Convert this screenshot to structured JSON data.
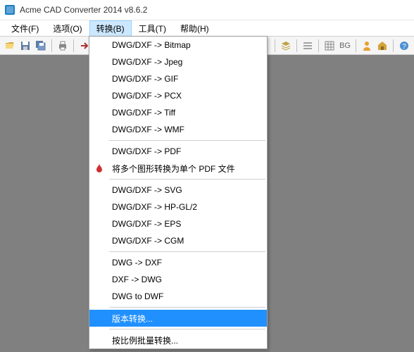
{
  "window": {
    "title": "Acme CAD Converter 2014 v8.6.2"
  },
  "menubar": {
    "items": [
      {
        "label": "文件(F)"
      },
      {
        "label": "选项(O)"
      },
      {
        "label": "转换(B)"
      },
      {
        "label": "工具(T)"
      },
      {
        "label": "帮助(H)"
      }
    ]
  },
  "toolbar": {
    "bg_label": "BG"
  },
  "dropdown": {
    "items": [
      {
        "label": "DWG/DXF -> Bitmap",
        "type": "item"
      },
      {
        "label": "DWG/DXF -> Jpeg",
        "type": "item"
      },
      {
        "label": "DWG/DXF -> GIF",
        "type": "item"
      },
      {
        "label": "DWG/DXF -> PCX",
        "type": "item"
      },
      {
        "label": "DWG/DXF -> Tiff",
        "type": "item"
      },
      {
        "label": "DWG/DXF -> WMF",
        "type": "item"
      },
      {
        "type": "sep"
      },
      {
        "label": "DWG/DXF -> PDF",
        "type": "item"
      },
      {
        "label": "将多个图形转换为单个 PDF 文件",
        "type": "item",
        "icon": "pdf"
      },
      {
        "type": "sep"
      },
      {
        "label": "DWG/DXF -> SVG",
        "type": "item"
      },
      {
        "label": "DWG/DXF -> HP-GL/2",
        "type": "item"
      },
      {
        "label": "DWG/DXF -> EPS",
        "type": "item"
      },
      {
        "label": "DWG/DXF -> CGM",
        "type": "item"
      },
      {
        "type": "sep"
      },
      {
        "label": "DWG -> DXF",
        "type": "item"
      },
      {
        "label": "DXF -> DWG",
        "type": "item"
      },
      {
        "label": "DWG to DWF",
        "type": "item"
      },
      {
        "type": "sep"
      },
      {
        "label": "版本转换...",
        "type": "item",
        "highlighted": true
      },
      {
        "type": "sep"
      },
      {
        "label": "按比例批量转换...",
        "type": "item"
      }
    ]
  }
}
